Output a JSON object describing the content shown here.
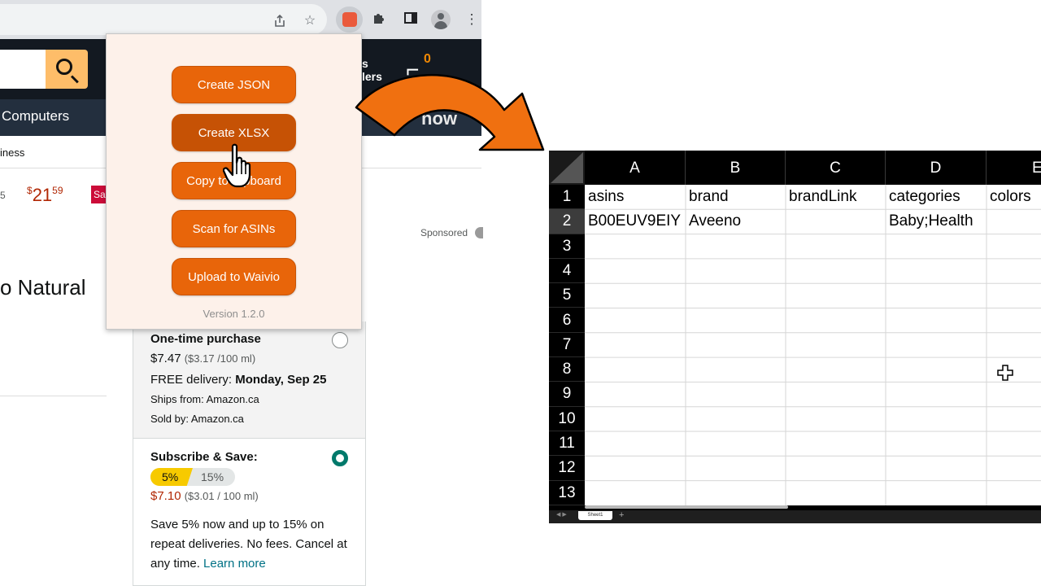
{
  "amazon": {
    "returns_line1": "s",
    "returns_line2": "lers",
    "cart_count": "0",
    "nav_item": "Computers",
    "banner_text": "now",
    "subnav_text": "iness",
    "price_fragment": "5",
    "price_symbol": "$",
    "price_whole": "21",
    "price_fraction": "59",
    "sale_badge": "Sa",
    "sponsored": "Sponsored",
    "product_title": "o Natural"
  },
  "buybox": {
    "one_time": {
      "title": "One-time purchase",
      "price": "$7.47",
      "unit_price": "($3.17 /100 ml)",
      "delivery_label": "FREE delivery:",
      "delivery_date": "Monday, Sep 25",
      "ships_from": "Ships from: Amazon.ca",
      "sold_by": "Sold by: Amazon.ca"
    },
    "subscribe": {
      "title": "Subscribe & Save:",
      "discount_a": "5%",
      "discount_b": "15%",
      "price": "$7.10",
      "unit_price": "($3.01 / 100 ml)",
      "description": "Save 5% now and up to 15% on repeat deliveries. No fees. Cancel at any time.",
      "learn_more": "Learn more"
    }
  },
  "popup": {
    "buttons": [
      {
        "label": "Create JSON"
      },
      {
        "label": "Create XLSX"
      },
      {
        "label": "Copy to clipboard"
      },
      {
        "label": "Scan for ASINs"
      },
      {
        "label": "Upload to Waivio"
      }
    ],
    "version": "Version 1.2.0"
  },
  "sheet": {
    "columns": [
      "A",
      "B",
      "C",
      "D",
      "E"
    ],
    "rows": [
      "1",
      "2",
      "3",
      "4",
      "5",
      "6",
      "7",
      "8",
      "9",
      "10",
      "11",
      "12",
      "13"
    ],
    "cells": {
      "r1": [
        "asins",
        "brand",
        "brandLink",
        "categories",
        "colors"
      ],
      "r2": [
        "B00EUV9EIY",
        "Aveeno",
        "",
        "Baby;Health",
        ""
      ]
    },
    "tab_name": "Sheet1",
    "add_tab": "+"
  },
  "colors": {
    "accent_orange": "#e8650a",
    "amazon_dark": "#131921",
    "amazon_nav": "#232f3e",
    "subscribe_teal": "#00796b"
  }
}
